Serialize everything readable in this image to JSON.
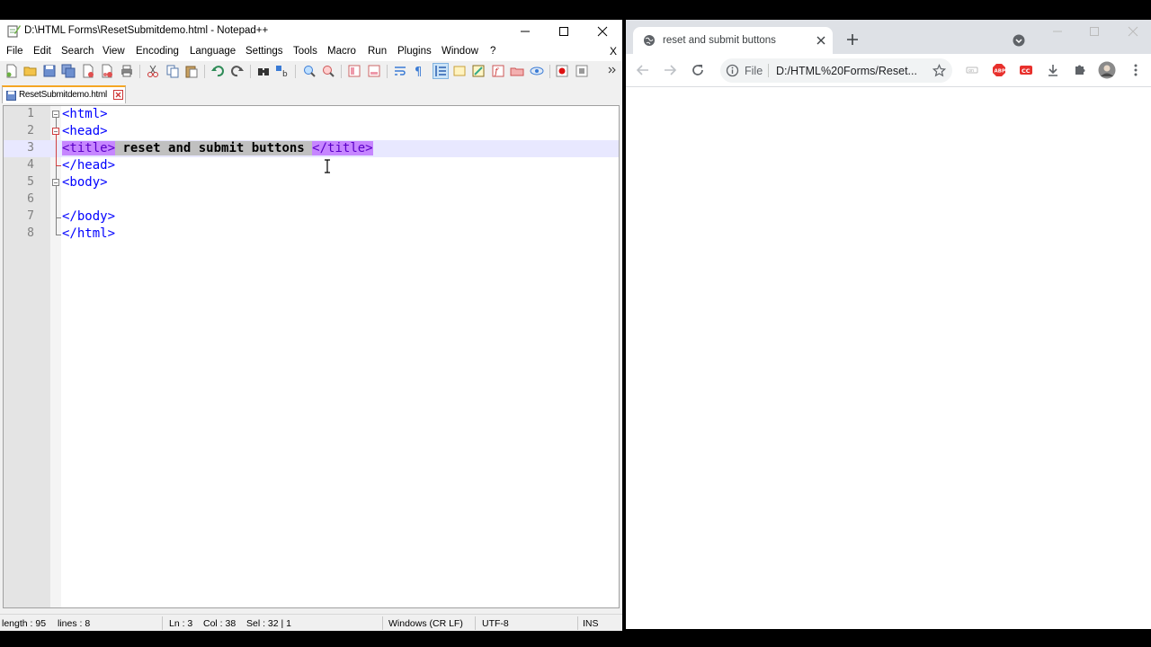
{
  "notepad": {
    "title": "D:\\HTML Forms\\ResetSubmitdemo.html - Notepad++",
    "menu": [
      "File",
      "Edit",
      "Search",
      "View",
      "Encoding",
      "Language",
      "Settings",
      "Tools",
      "Macro",
      "Run",
      "Plugins",
      "Window",
      "?"
    ],
    "menu_close": "X",
    "tab_label": "ResetSubmitdemo.html",
    "line_numbers": [
      "1",
      "2",
      "3",
      "4",
      "5",
      "6",
      "7",
      "8"
    ],
    "code": {
      "l1": "<html>",
      "l2": "<head>",
      "l3_open": "<title>",
      "l3_text": " reset and submit buttons ",
      "l3_close": "</title>",
      "l4": "</head>",
      "l5": "<body>",
      "l7": "</body>",
      "l8": "</html>"
    },
    "status": {
      "length": "length : 95",
      "lines": "lines : 8",
      "ln": "Ln : 3",
      "col": "Col : 38",
      "sel": "Sel : 32 | 1",
      "eol": "Windows (CR LF)",
      "encoding": "UTF-8",
      "mode": "INS"
    }
  },
  "chrome": {
    "tab_title": "reset and submit buttons",
    "omnibox_scheme": "File",
    "omnibox_url": "D:/HTML%20Forms/Reset..."
  },
  "colors": {
    "tag": "#0000ff",
    "tag_selected_bg": "#c686ff",
    "text_selected_bg": "#c0c0c0",
    "tab_accent": "#f5a623"
  }
}
